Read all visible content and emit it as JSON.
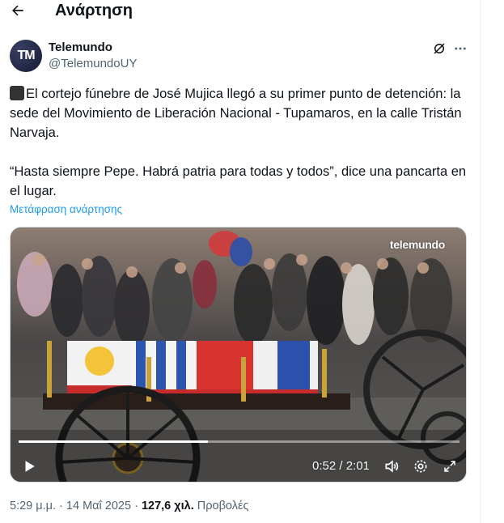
{
  "header": {
    "title": "Ανάρτηση",
    "back_icon": "arrow-left-icon"
  },
  "author": {
    "avatar_text": "TM",
    "display_name": "Telemundo",
    "handle": "@TelemundoUY"
  },
  "tweet": {
    "paragraphs": [
      "El cortejo fúnebre de José Mujica llegó a su primer punto de detención: la sede del Movimiento de Liberación Nacional - Tupamaros, en la calle Tristán Narvaja.",
      "“Hasta siempre Pepe. Habrá patria para todas y todos”, dice una pancarta en el lugar."
    ],
    "translate_label": "Μετάφραση ανάρτησης"
  },
  "video": {
    "watermark": "telemundo",
    "time_display": "0:52 / 2:01",
    "progress_fraction": 0.43,
    "icons": [
      "play-icon",
      "volume-icon",
      "settings-icon",
      "fullscreen-icon"
    ]
  },
  "meta": {
    "time": "5:29 μ.μ.",
    "separator": " · ",
    "date": "14 Μαΐ 2025",
    "separator2": " · ",
    "views_count": "127,6 χιλ.",
    "views_label": "Προβολές"
  },
  "colors": {
    "link": "#1d9bf0",
    "secondary_text": "#536471"
  }
}
